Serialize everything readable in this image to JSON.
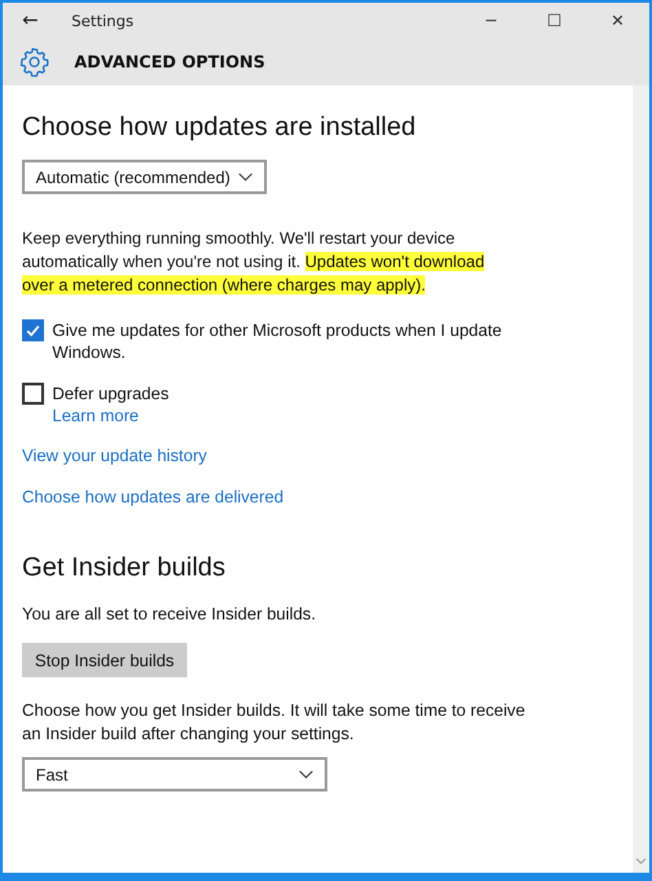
{
  "window": {
    "title": "Settings",
    "back": "←",
    "controls": [
      "─",
      "☐",
      "✕"
    ]
  },
  "header": {
    "title": "ADVANCED OPTIONS"
  },
  "install_section": {
    "heading": "Choose how updates are installed",
    "dropdown": {
      "value": "Automatic (recommended)"
    },
    "description": {
      "text": "Keep everything running smoothly. We'll restart your device automatically when you're not using it. ",
      "highlighted": "Updates won't download over a metered connection (where charges may apply)."
    },
    "options": [
      {
        "label": "Give me updates for other Microsoft products when I update Windows.",
        "checked": true
      },
      {
        "label": "Defer upgrades",
        "checked": false,
        "link": "Learn more"
      }
    ],
    "links": [
      "View your update history",
      "Choose how updates are delivered"
    ]
  },
  "insider_section": {
    "heading": "Get Insider builds",
    "status": "You are all set to receive Insider builds.",
    "button": "Stop Insider builds",
    "description": "Choose how you get Insider builds. It will take some time to receive an Insider build after changing your settings.",
    "dropdown": {
      "value": "Fast"
    }
  }
}
